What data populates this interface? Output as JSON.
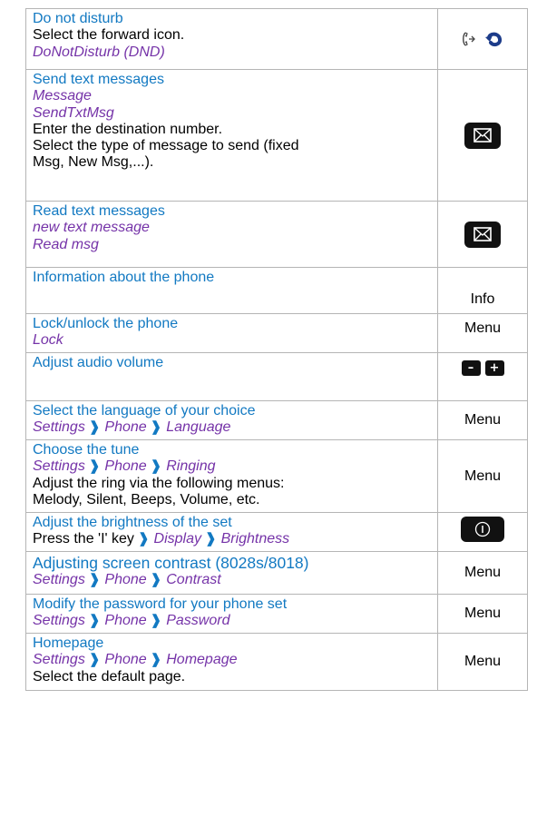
{
  "rows": [
    {
      "title": "Do not disturb",
      "lines": [
        "Select the forward icon."
      ],
      "menu": "DoNotDisturb (DND)",
      "icon": "forward-icon"
    },
    {
      "title": "Send text messages",
      "menu1": "Message",
      "menu2": "SendTxtMsg",
      "lines": [
        "Enter the destination number.",
        "Select the type of message to send (fixed",
        "Msg, New Msg,...)."
      ],
      "icon": "envelope-key-icon"
    },
    {
      "title": "Read text messages",
      "menu1": "new text message",
      "menu2": "Read msg",
      "icon": "envelope-key-icon"
    },
    {
      "title": "Information about the phone",
      "action": "Info"
    },
    {
      "title": "Lock/unlock the phone",
      "menu": "Lock",
      "action": "Menu"
    },
    {
      "title": "Adjust audio volume",
      "minus": "–",
      "plus": "+"
    },
    {
      "title": "Select the language of your choice",
      "path": [
        "Settings",
        "Phone",
        "Language"
      ],
      "action": "Menu"
    },
    {
      "title": "Choose the tune",
      "path": [
        "Settings",
        "Phone",
        "Ringing"
      ],
      "lines": [
        "Adjust the ring via the following menus:",
        "Melody, Silent, Beeps, Volume, etc."
      ],
      "action": "Menu"
    },
    {
      "title": "Adjust the brightness of the set",
      "prefix": "Press the 'I' key",
      "path": [
        "Display",
        "Brightness"
      ],
      "icon": "info-key-icon"
    },
    {
      "title": "Adjusting screen contrast (8028s/8018)",
      "path": [
        "Settings",
        "Phone",
        "Contrast"
      ],
      "action": "Menu"
    },
    {
      "title": "Modify the password for your phone set",
      "path": [
        "Settings",
        "Phone",
        "Password"
      ],
      "action": "Menu"
    },
    {
      "title": "Homepage",
      "path": [
        "Settings",
        "Phone",
        "Homepage"
      ],
      "lines": [
        "Select the default page."
      ],
      "action": "Menu"
    }
  ],
  "separator": "❱",
  "colors": {
    "title": "#1279c2",
    "menu": "#7533a8",
    "border": "#b5b5b5",
    "key": "#111111"
  }
}
